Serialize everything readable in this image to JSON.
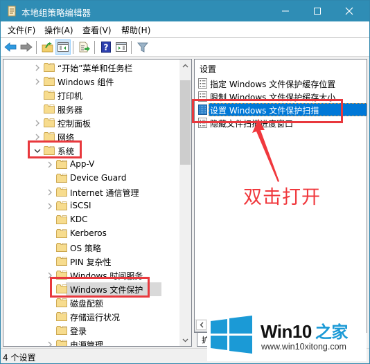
{
  "window": {
    "title": "本地组策略编辑器",
    "controls": {
      "minimize": "minimize",
      "maximize": "maximize",
      "close": "close"
    }
  },
  "menubar": {
    "items": [
      {
        "label": "文件(F)"
      },
      {
        "label": "操作(A)"
      },
      {
        "label": "查看(V)"
      },
      {
        "label": "帮助(H)"
      }
    ]
  },
  "toolbar": {
    "buttons": [
      {
        "name": "back",
        "icon": "arrow-left-icon"
      },
      {
        "name": "forward",
        "icon": "arrow-right-icon"
      },
      {
        "name": "up-level",
        "icon": "folder-up-icon"
      },
      {
        "name": "show-hide-tree",
        "icon": "console-tree-icon",
        "active": true
      },
      {
        "name": "export-list",
        "icon": "export-list-icon"
      },
      {
        "name": "help",
        "icon": "help-icon"
      },
      {
        "name": "show-hide-action-pane",
        "icon": "action-pane-icon"
      },
      {
        "name": "filter",
        "icon": "filter-icon"
      }
    ]
  },
  "tree": {
    "items": [
      {
        "label": "“开始”菜单和任务栏",
        "level": 1,
        "expandable": true,
        "expanded": false
      },
      {
        "label": "Windows 组件",
        "level": 1,
        "expandable": true,
        "expanded": false
      },
      {
        "label": "打印机",
        "level": 1,
        "expandable": false
      },
      {
        "label": "服务器",
        "level": 1,
        "expandable": false
      },
      {
        "label": "控制面板",
        "level": 1,
        "expandable": true,
        "expanded": false
      },
      {
        "label": "网络",
        "level": 1,
        "expandable": true,
        "expanded": false
      },
      {
        "label": "系统",
        "level": 1,
        "expandable": true,
        "expanded": true,
        "highlighted": true
      },
      {
        "label": "App-V",
        "level": 2,
        "expandable": true,
        "expanded": false
      },
      {
        "label": "Device Guard",
        "level": 2,
        "expandable": false
      },
      {
        "label": "Internet 通信管理",
        "level": 2,
        "expandable": true,
        "expanded": false
      },
      {
        "label": "iSCSI",
        "level": 2,
        "expandable": true,
        "expanded": false
      },
      {
        "label": "KDC",
        "level": 2,
        "expandable": false
      },
      {
        "label": "Kerberos",
        "level": 2,
        "expandable": false
      },
      {
        "label": "OS 策略",
        "level": 2,
        "expandable": false
      },
      {
        "label": "PIN 复杂性",
        "level": 2,
        "expandable": false
      },
      {
        "label": "Windows 时间服务",
        "level": 2,
        "expandable": true,
        "expanded": false
      },
      {
        "label": "Windows 文件保护",
        "level": 2,
        "expandable": false,
        "selected": true,
        "highlighted": true
      },
      {
        "label": "磁盘配额",
        "level": 2,
        "expandable": false
      },
      {
        "label": "存储运行状况",
        "level": 2,
        "expandable": false
      },
      {
        "label": "登录",
        "level": 2,
        "expandable": false
      },
      {
        "label": "电源管理",
        "level": 2,
        "expandable": true,
        "expanded": false
      }
    ]
  },
  "settings": {
    "column_header": "设置",
    "items": [
      {
        "label": "指定 Windows 文件保护缓存位置",
        "selected": false
      },
      {
        "label": "限制 Windows 文件保护缓存大小",
        "selected": false
      },
      {
        "label": "设置 Windows 文件保护扫描",
        "selected": true,
        "highlighted": true
      },
      {
        "label": "隐藏文件扫描进度窗口",
        "selected": false
      }
    ]
  },
  "tabs": {
    "extended": "扩"
  },
  "status": {
    "text": "4 个设置"
  },
  "annotation": {
    "text": "双击打开",
    "color": "#f0383d"
  },
  "watermark": {
    "brand": "Win10",
    "accent": "之家",
    "url": "www.win10xitong.com",
    "accent_color": "#1b9ad6"
  },
  "colors": {
    "titlebar": "#2f8db5",
    "selection": "#0078d7",
    "highlight_box": "#e8383d"
  }
}
